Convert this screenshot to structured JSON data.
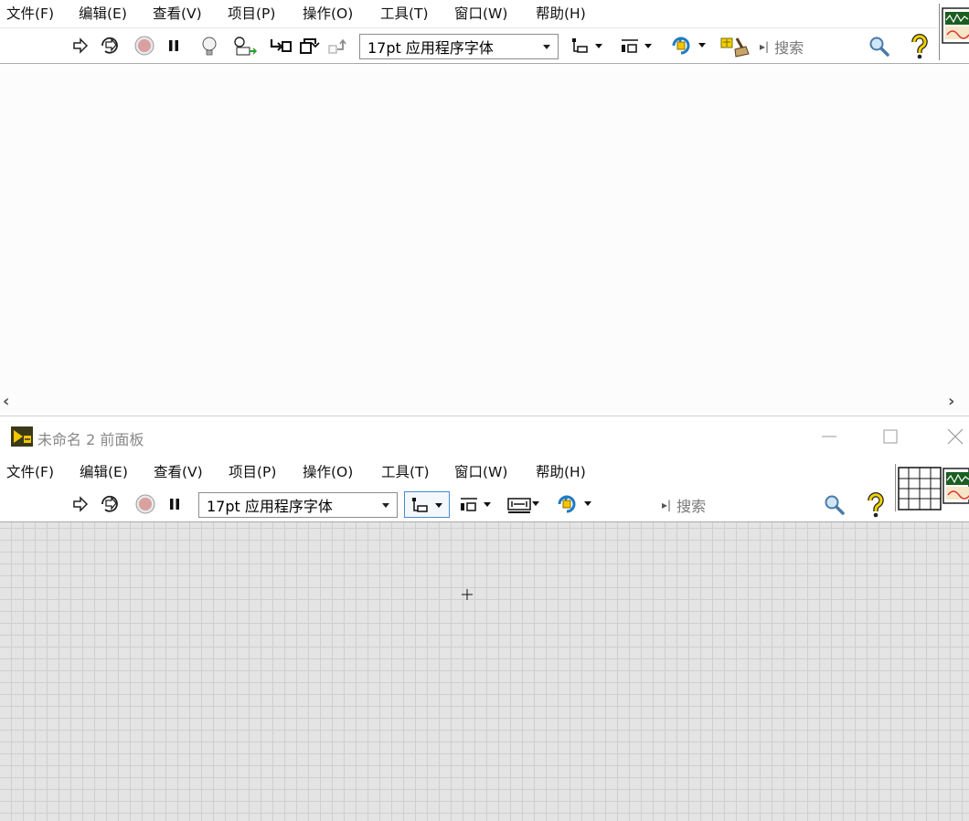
{
  "block_diagram": {
    "menu": [
      "文件(F)",
      "编辑(E)",
      "查看(V)",
      "项目(P)",
      "操作(O)",
      "工具(T)",
      "窗口(W)",
      "帮助(H)"
    ],
    "font_select": "17pt 应用程序字体",
    "search_placeholder": "搜索"
  },
  "front_panel": {
    "title": "未命名 2 前面板",
    "menu": [
      "文件(F)",
      "编辑(E)",
      "查看(V)",
      "项目(P)",
      "操作(O)",
      "工具(T)",
      "窗口(W)",
      "帮助(H)"
    ],
    "font_select": "17pt 应用程序字体",
    "search_placeholder": "搜索"
  },
  "colors": {
    "grid_background": "#e4e4e4",
    "grid_line": "#cfcfcf",
    "help_icon": "#f2d100",
    "stop_icon": "#d9a0a0",
    "selected_border": "#4a8ad0"
  }
}
